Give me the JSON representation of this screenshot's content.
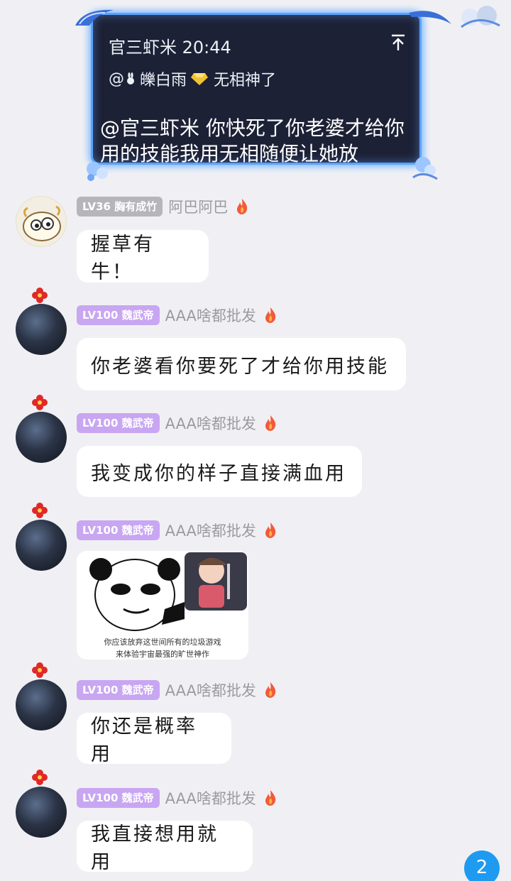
{
  "reply": {
    "header": "官三虾米 20:44",
    "quote_prefix": "@",
    "quote_name": "皪白雨",
    "quote_text": "无相神了",
    "body": "@官三虾米 你快死了你老婆才给你用的技能我用无相随便让她放"
  },
  "messages": [
    {
      "level": "LV36 胸有成竹",
      "nick": "阿巴阿巴",
      "text": "握草有牛！"
    },
    {
      "level": "LV100 魏武帝",
      "nick": "AAA啥都批发",
      "text": "你老婆看你要死了才给你用技能"
    },
    {
      "level": "LV100 魏武帝",
      "nick": "AAA啥都批发",
      "text": "我变成你的样子直接满血用"
    },
    {
      "level": "LV100 魏武帝",
      "nick": "AAA啥都批发",
      "sticker_caption_1": "你应该放弃这世间所有的垃圾游戏",
      "sticker_caption_2": "来体验宇宙最强的旷世神作"
    },
    {
      "level": "LV100 魏武帝",
      "nick": "AAA啥都批发",
      "text": "你还是概率用"
    },
    {
      "level": "LV100 魏武帝",
      "nick": "AAA啥都批发",
      "text": "我直接想用就用"
    }
  ],
  "unread_count": "2",
  "colors": {
    "accent": "#1e9bf0",
    "badge_purple": "#c8a6f2",
    "badge_grey": "#b5b5bb",
    "card_bg": "#1c2136",
    "card_glow": "#5aa2ff"
  }
}
